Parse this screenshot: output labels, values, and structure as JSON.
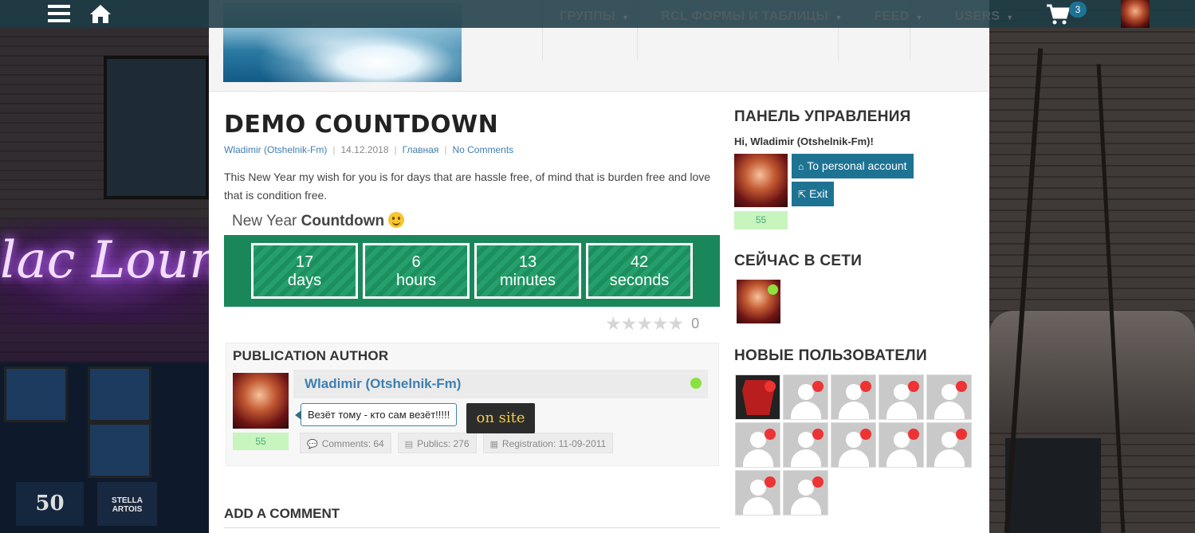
{
  "topbar": {
    "nav": [
      {
        "label": "ГРУППЫ"
      },
      {
        "label": "RCL ФОРМЫ И ТАБЛИЦЫ"
      },
      {
        "label": "FEED"
      },
      {
        "label": "USERS"
      }
    ],
    "cart_count": "3"
  },
  "post": {
    "title": "DEMO COUNTDOWN",
    "author": "Wladimir (Otshelnik-Fm)",
    "date": "14.12.2018",
    "category": "Главная",
    "comments_link": "No Comments",
    "excerpt": "This New Year my wish for you is for days that are hassle free, of mind that is burden free and love that is condition free."
  },
  "countdown": {
    "title_prefix": "New Year ",
    "title_bold": "Countdown",
    "cells": [
      {
        "value": "17",
        "unit": "days"
      },
      {
        "value": "6",
        "unit": "hours"
      },
      {
        "value": "13",
        "unit": "minutes"
      },
      {
        "value": "42",
        "unit": "seconds"
      }
    ],
    "bg_color": "#19875a"
  },
  "rating": {
    "stars": "★★★★★",
    "stars_filled": 0,
    "count": "0"
  },
  "author_box": {
    "title": "PUBLICATION AUTHOR",
    "name": "Wladimir (Otshelnik-Fm)",
    "rating": "55",
    "status": "Везёт тому - кто сам везёт!!!!!",
    "comments": "Comments: 64",
    "publics": "Publics: 276",
    "registration": "Registration: 11-09-2011"
  },
  "add_comment": "ADD A COMMENT",
  "on_site_label": "on site",
  "sidebar": {
    "panel_title": "ПАНЕЛЬ УПРАВЛЕНИЯ",
    "greeting": "Hi, Wladimir (Otshelnik-Fm)!",
    "personal_account": "To personal account",
    "exit": "Exit",
    "rating": "55",
    "online_title": "СЕЙЧАС В СЕТИ",
    "new_users_title": "НОВЫЕ ПОЛЬЗОВАТЕЛИ"
  },
  "colors": {
    "accent": "#1e7393",
    "link": "#3f7fb0",
    "online": "#8be23e",
    "offline": "#e33333"
  }
}
